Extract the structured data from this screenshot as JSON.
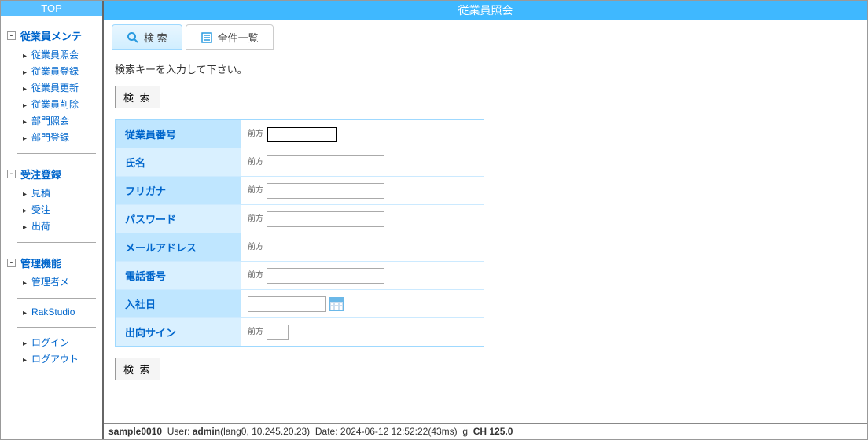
{
  "sidebar": {
    "top": "TOP",
    "groups": [
      {
        "title": "従業員メンテ",
        "items": [
          "従業員照会",
          "従業員登録",
          "従業員更新",
          "従業員削除",
          "部門照会",
          "部門登録"
        ]
      },
      {
        "title": "受注登録",
        "items": [
          "見積",
          "受注",
          "出荷"
        ]
      },
      {
        "title": "管理機能",
        "items": [
          "管理者メ"
        ]
      }
    ],
    "extra1": "RakStudio",
    "extra2": [
      "ログイン",
      "ログアウト"
    ]
  },
  "header": {
    "title": "従業員照会"
  },
  "tabs": {
    "search": "検 索",
    "list": "全件一覧"
  },
  "content": {
    "instruction": "検索キーを入力して下さい。",
    "search_btn": "検 索",
    "prefix": "前方",
    "fields": {
      "emp_no": "従業員番号",
      "name": "氏名",
      "furigana": "フリガナ",
      "password": "パスワード",
      "email": "メールアドレス",
      "phone": "電話番号",
      "join_date": "入社日",
      "secondment": "出向サイン"
    }
  },
  "status": {
    "app": "sample0010",
    "user_label": "User:",
    "user": "admin",
    "user_detail": "(lang0, 10.245.20.23)",
    "date_label": "Date:",
    "date": "2024-06-12 12:52:22(43ms)",
    "g": "g",
    "ch_label": "CH",
    "ch": "125.0"
  }
}
